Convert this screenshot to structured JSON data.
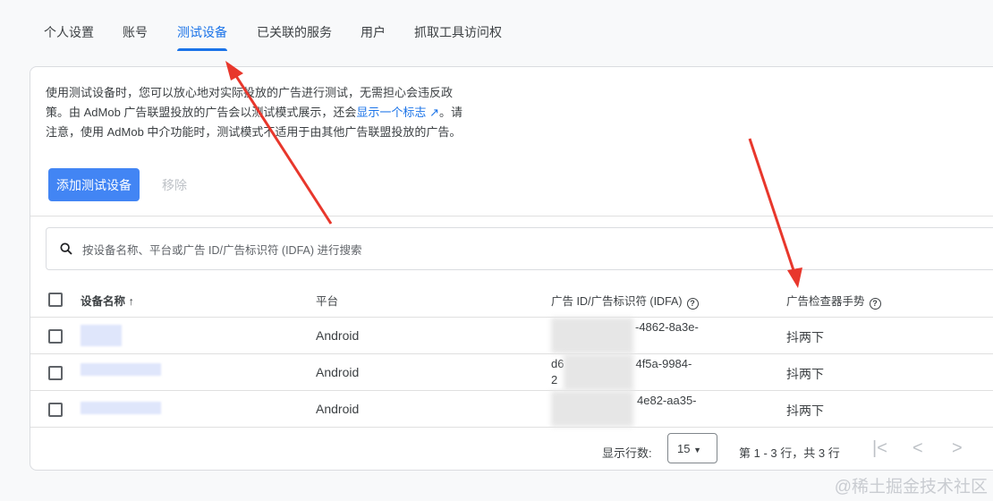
{
  "tabs": [
    "个人设置",
    "账号",
    "测试设备",
    "已关联的服务",
    "用户",
    "抓取工具访问权"
  ],
  "active_tab": "测试设备",
  "description": {
    "part1": "使用测试设备时，您可以放心地对实际投放的广告进行测试，无需担心会违反政策。由 AdMob 广告联盟投放的广告会以测试模式展示，还会",
    "link": "显示一个标志",
    "part2": "。请注意，使用 AdMob 中介功能时，测试模式不适用于由其他广告联盟投放的广告。"
  },
  "buttons": {
    "add": "添加测试设备",
    "remove": "移除"
  },
  "search": {
    "placeholder": "按设备名称、平台或广告 ID/广告标识符 (IDFA) 进行搜索"
  },
  "table": {
    "headers": [
      "设备名称",
      "平台",
      "广告 ID/广告标识符 (IDFA)",
      "广告检查器手势"
    ],
    "rows": [
      {
        "platform": "Android",
        "id_visible": "-4862-8a3e-",
        "id_line2": "",
        "gesture": "抖两下"
      },
      {
        "platform": "Android",
        "id_visible": "4f5a-9984-",
        "id_prefix": "d6",
        "id_line2": "2",
        "gesture": "抖两下"
      },
      {
        "platform": "Android",
        "id_visible": "4e82-aa35-",
        "id_line2": "",
        "gesture": "抖两下"
      }
    ]
  },
  "pagination": {
    "rows_label": "显示行数:",
    "rows_value": "15",
    "range": "第 1 - 3 行，共 3 行"
  },
  "watermark": "@稀土掘金技术社区",
  "colors": {
    "accent": "#1a73e8",
    "button": "#4285f4",
    "arrow": "#e8372c"
  }
}
